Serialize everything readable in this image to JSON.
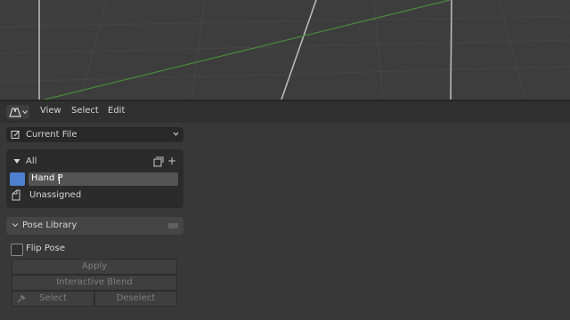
{
  "header": {
    "menu": [
      {
        "label": "View"
      },
      {
        "label": "Select"
      },
      {
        "label": "Edit"
      }
    ],
    "editor_type_icon": "pose-library-editor-icon"
  },
  "library": {
    "current": "Current File",
    "icon": "edit-file-icon"
  },
  "catalog": {
    "all_label": "All",
    "editing_value": "Hand P",
    "unassigned_label": "Unassigned",
    "swatch_color": "#4f7fd1"
  },
  "pose_panel": {
    "title": "Pose Library",
    "flip_label": "Flip Pose",
    "apply_label": "Apply",
    "blend_label": "Interactive Blend",
    "select_label": "Select",
    "deselect_label": "Deselect"
  },
  "colors": {
    "viewport_bg": "#3d3d3d",
    "panel_bg": "#383838",
    "x_axis": "#4a8a3a",
    "accent": "#4f7fd1"
  }
}
